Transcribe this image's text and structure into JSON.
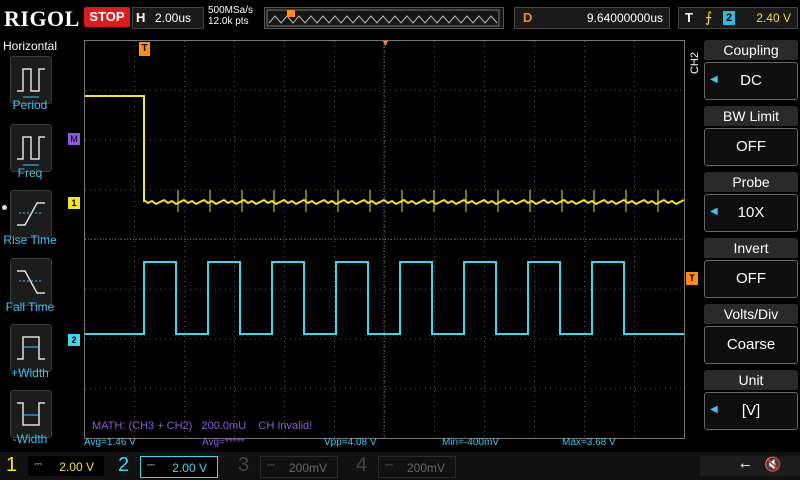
{
  "brand": "RIGOL",
  "run_state": "STOP",
  "timebase": {
    "key": "H",
    "value": "2.00us"
  },
  "sampling": {
    "rate": "500MSa/s",
    "points": "12.0k pts"
  },
  "delay": {
    "key": "D",
    "value": "9.64000000us"
  },
  "trigger": {
    "key": "T",
    "edge": "⨍",
    "source": "2",
    "level": "2.40 V"
  },
  "left_menu": {
    "title": "Horizontal",
    "items": [
      "Period",
      "Freq",
      "Rise Time",
      "Fall Time",
      "+Width",
      "-Width"
    ]
  },
  "right_menu": {
    "channel": "CH2",
    "items": [
      {
        "title": "Coupling",
        "value": "DC",
        "arrow": true
      },
      {
        "title": "BW Limit",
        "value": "OFF",
        "arrow": false
      },
      {
        "title": "Probe",
        "value": "10X",
        "arrow": true
      },
      {
        "title": "Invert",
        "value": "OFF",
        "arrow": false
      },
      {
        "title": "Volts/Div",
        "value": "Coarse",
        "arrow": false
      },
      {
        "title": "Unit",
        "value": "[V]",
        "arrow": true
      }
    ]
  },
  "markers": {
    "trigger_T": "T",
    "math_M": "M",
    "ch1": "1",
    "ch2": "2",
    "trig_level_T": "T"
  },
  "math_line": {
    "label": "MATH: (CH3 + CH2)",
    "scale": "200.0mU",
    "status": "CH Invalid!"
  },
  "measurements": {
    "avg1": "Avg=1.46 V",
    "avg2": "Avg=*****",
    "vpp": "Vpp=4.08 V",
    "min": "Min=-400mV",
    "max": "Max=3.68 V"
  },
  "channels": [
    {
      "num": "1",
      "coupling": "⎓",
      "scale": "2.00 V",
      "color": "#f0e62a",
      "active": true
    },
    {
      "num": "2",
      "coupling": "⎓",
      "scale": "2.00 V",
      "color": "#3fd6f0",
      "active": true
    },
    {
      "num": "3",
      "coupling": "⎓",
      "scale": "200mV",
      "color": "#c84fc8",
      "active": false
    },
    {
      "num": "4",
      "coupling": "⎓",
      "scale": "200mV",
      "color": "#3a78d8",
      "active": false
    }
  ],
  "colors": {
    "ch1": "#f0e62a",
    "ch2": "#3fd6f0",
    "math": "#8a5bd6",
    "trigger": "#ff8c1a",
    "stop": "#d81e1e"
  }
}
